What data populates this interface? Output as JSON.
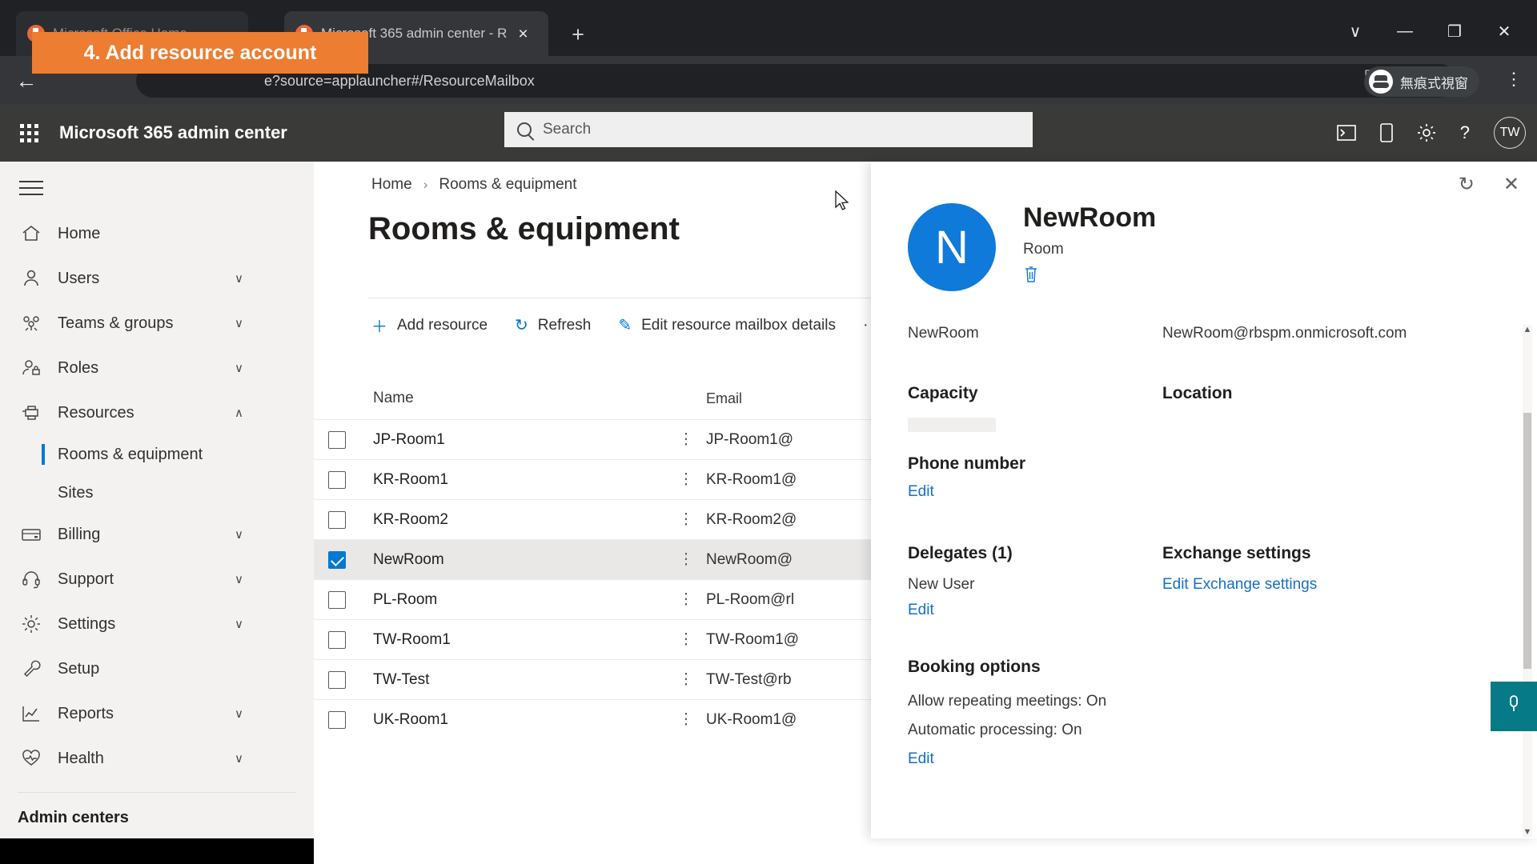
{
  "browser": {
    "tabs": [
      {
        "title": "Microsoft Office Home",
        "close_label": "×",
        "active": false
      },
      {
        "title": "Microsoft 365 admin center - R",
        "close_label": "×",
        "active": true
      }
    ],
    "new_tab_label": "+",
    "window_controls": {
      "minimize": "—",
      "maximize": "❐",
      "close": "✕",
      "tab_search": "∨"
    },
    "back_label": "←",
    "url": "e?source=applauncher#/ResourceMailbox",
    "omni_icons": {
      "translate": "⧉",
      "block": "⦸",
      "bookmark": "☆"
    },
    "incognito_label": "無痕式視窗",
    "menu_label": "⋮"
  },
  "annotation": {
    "text": "4. Add resource account",
    "color": "#ed7d31"
  },
  "suite_header": {
    "title": "Microsoft 365 admin center",
    "search_placeholder": "Search",
    "icons": [
      "console-icon",
      "mobile-icon",
      "gear-icon",
      "help-icon"
    ],
    "help_label": "?",
    "avatar_initials": "TW"
  },
  "sidebar": {
    "items": [
      {
        "label": "Home",
        "icon": "home-icon",
        "chevron": false
      },
      {
        "label": "Users",
        "icon": "user-icon",
        "chevron": true
      },
      {
        "label": "Teams & groups",
        "icon": "teams-icon",
        "chevron": true
      },
      {
        "label": "Roles",
        "icon": "roles-icon",
        "chevron": true
      },
      {
        "label": "Resources",
        "icon": "resources-icon",
        "chevron": true,
        "expanded": true
      }
    ],
    "sub_items": [
      {
        "label": "Rooms & equipment",
        "active": true
      },
      {
        "label": "Sites",
        "active": false
      }
    ],
    "items2": [
      {
        "label": "Billing",
        "icon": "billing-icon",
        "chevron": true
      },
      {
        "label": "Support",
        "icon": "support-icon",
        "chevron": true
      },
      {
        "label": "Settings",
        "icon": "settings-icon",
        "chevron": true
      },
      {
        "label": "Setup",
        "icon": "setup-icon",
        "chevron": false
      },
      {
        "label": "Reports",
        "icon": "reports-icon",
        "chevron": true
      },
      {
        "label": "Health",
        "icon": "health-icon",
        "chevron": true
      }
    ],
    "footer_label": "Admin centers",
    "chevron_down": "∨",
    "chevron_up": "∧"
  },
  "main": {
    "breadcrumb": {
      "home": "Home",
      "separator": "›",
      "current": "Rooms & equipment"
    },
    "page_title": "Rooms & equipment",
    "commands": [
      {
        "label": "Add resource",
        "icon": "plus-icon",
        "glyph": "＋"
      },
      {
        "label": "Refresh",
        "icon": "refresh-icon",
        "glyph": "↻"
      },
      {
        "label": "Edit resource mailbox details",
        "icon": "pencil-icon",
        "glyph": "✎"
      }
    ],
    "commands_overflow": "···",
    "table": {
      "columns": [
        "Name",
        "Email"
      ],
      "row_menu_glyph": "⋮",
      "rows": [
        {
          "name": "JP-Room1",
          "email": "JP-Room1@",
          "selected": false
        },
        {
          "name": "KR-Room1",
          "email": "KR-Room1@",
          "selected": false
        },
        {
          "name": "KR-Room2",
          "email": "KR-Room2@",
          "selected": false
        },
        {
          "name": "NewRoom",
          "email": "NewRoom@",
          "selected": true
        },
        {
          "name": "PL-Room",
          "email": "PL-Room@rl",
          "selected": false
        },
        {
          "name": "TW-Room1",
          "email": "TW-Room1@",
          "selected": false
        },
        {
          "name": "TW-Test",
          "email": "TW-Test@rb",
          "selected": false
        },
        {
          "name": "UK-Room1",
          "email": "UK-Room1@",
          "selected": false
        }
      ]
    }
  },
  "panel": {
    "refresh_glyph": "↻",
    "close_glyph": "✕",
    "avatar_initial": "N",
    "name": "NewRoom",
    "type": "Room",
    "delete_glyph": "🗑",
    "display_name": "NewRoom",
    "email": "NewRoom@rbspm.onmicrosoft.com",
    "capacity_label": "Capacity",
    "location_label": "Location",
    "phone_label": "Phone number",
    "phone_edit": "Edit",
    "delegates_label": "Delegates (1)",
    "delegate_name": "New User",
    "delegates_edit": "Edit",
    "exchange_label": "Exchange settings",
    "exchange_link": "Edit Exchange settings",
    "booking_label": "Booking options",
    "booking_repeating": "Allow repeating meetings: On",
    "booking_auto": "Automatic processing: On",
    "booking_edit": "Edit",
    "scroll_up": "▲",
    "scroll_down": "▼"
  },
  "feedback": {
    "icon": "feedback-icon",
    "glyph": "⌨",
    "color": "#067a87"
  }
}
